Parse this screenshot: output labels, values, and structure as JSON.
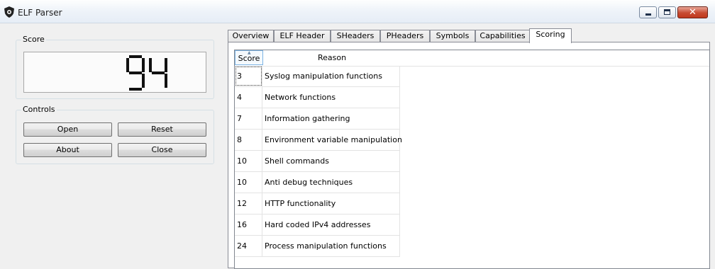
{
  "window": {
    "title": "ELF Parser",
    "icon": "shield-icon"
  },
  "score_panel": {
    "label": "Score",
    "value": "94"
  },
  "controls": {
    "label": "Controls",
    "buttons": {
      "open": "Open",
      "reset": "Reset",
      "about": "About",
      "close": "Close"
    }
  },
  "tabs": [
    {
      "label": "Overview"
    },
    {
      "label": "ELF Header"
    },
    {
      "label": "SHeaders"
    },
    {
      "label": "PHeaders"
    },
    {
      "label": "Symbols"
    },
    {
      "label": "Capabilities"
    },
    {
      "label": "Scoring",
      "active": true
    }
  ],
  "scoring_table": {
    "headers": {
      "score": "Score",
      "reason": "Reason"
    },
    "rows": [
      {
        "score": "3",
        "reason": "Syslog manipulation functions"
      },
      {
        "score": "4",
        "reason": "Network functions"
      },
      {
        "score": "7",
        "reason": "Information gathering"
      },
      {
        "score": "8",
        "reason": "Environment variable manipulation"
      },
      {
        "score": "10",
        "reason": "Shell commands"
      },
      {
        "score": "10",
        "reason": "Anti debug techniques"
      },
      {
        "score": "12",
        "reason": "HTTP functionality"
      },
      {
        "score": "16",
        "reason": "Hard coded IPv4 addresses"
      },
      {
        "score": "24",
        "reason": "Process manipulation functions"
      }
    ]
  }
}
